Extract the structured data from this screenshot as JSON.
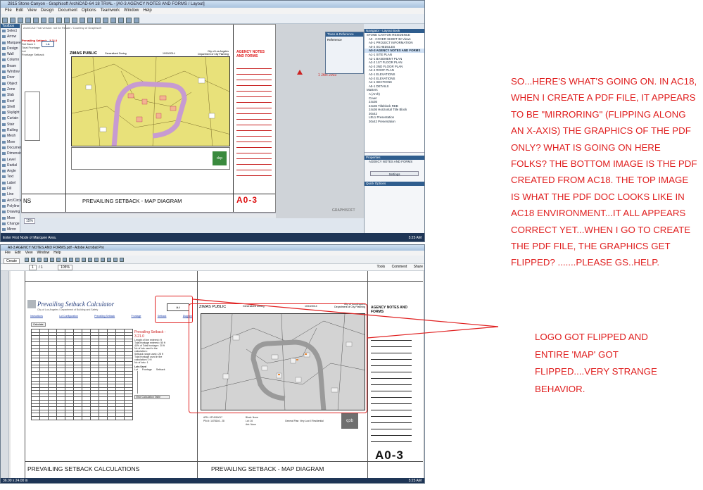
{
  "colors": {
    "annotation_red": "#e02020",
    "map_yellow": "#e8e17a",
    "map_purple": "#c79bd1"
  },
  "archicad": {
    "window_title": "2815 Stone Canyon - Graphisoft ArchiCAD-64 18 TRIAL - [A0-3 AGENCY NOTES AND FORMS / Layout]",
    "menu": [
      "File",
      "Edit",
      "View",
      "Design",
      "Document",
      "Options",
      "Teamwork",
      "Window",
      "Help"
    ],
    "toolbox_header": "Toolbox",
    "toolbox_items": [
      "Select",
      "Arrow",
      "Marquee",
      "Design",
      "Wall",
      "Column",
      "Beam",
      "Window",
      "Door",
      "Object",
      "Zone",
      "Slab",
      "Roof",
      "Shell",
      "Skylight",
      "Curtain",
      "Stair",
      "Railing",
      "Mesh",
      "More",
      "Document",
      "Dimension",
      "Level",
      "Radial",
      "Angle",
      "Text",
      "Label",
      "Fill",
      "Line",
      "Arc/Circle",
      "Polyline",
      "Drawing",
      "More",
      "Change",
      "Mirror"
    ],
    "sheet": {
      "header_note": "ArchiCAD Trial version: not for Resale / Courtesy of Graphisoft",
      "map_title": "ZIMAS PUBLIC",
      "map_subtitle": "Generalized Zoning",
      "map_date": "10/15/2014",
      "map_agency": "City of Los Angeles Department of City Planning",
      "agency_title": "AGENCY NOTES AND FORMS",
      "drawing_title": "PREVAILING SETBACK - MAP DIAGRAM",
      "left_title": "NS",
      "sheet_number": "A0-3",
      "left_items": [
        "Prevailing Setback - 3.21.0",
        "Set Back 1",
        "Total Frontage",
        "Lot",
        "Frontage Setback"
      ],
      "watermark": "GRAPHISOFT",
      "mark": "1 JAN 2003"
    },
    "trace_palette": {
      "title": "Trace & Reference",
      "label": "Reference"
    },
    "navigator": {
      "title": "Navigator - Layout Book",
      "items": [
        "STONE CANYON RESIDENCE",
        "A0 - COVER SHEET 32 Views",
        "A0-1 PROJECT INFORMATION",
        "A0-2 SCHEDULES",
        "A0-3 AGENCY NOTES AND FORMS",
        "A1-1 SITE PLAN",
        "A2-1 BASEMENT PLAN",
        "A2-2 1ST FLOOR PLAN",
        "A2-3 2ND FLOOR PLAN",
        "A2-4 ROOF PLAN",
        "A3-1 ELEVATIONS",
        "A3-2 ELEVATIONS",
        "A4-1 SECTIONS",
        "A5-1 DETAILS",
        "Masters",
        "A (Arch)",
        "Cover",
        "24x36",
        "24x36 Titleblock REB",
        "24x36 Horizontal Title Block",
        "30x42",
        "LEL1 Presentation",
        "30x42 Presentation"
      ],
      "properties": "Properties",
      "prop_value": "AGENCY NOTES AND FORMS",
      "settings": "Settings",
      "quick_options": "Quick Options"
    },
    "status": "Enter First Node of Marquee Area.",
    "zoom": "15%",
    "clock": "5:25 AM"
  },
  "acrobat": {
    "window_title": "A0-3 AGENCY NOTES AND FORMS.pdf - Adobe Acrobat Pro",
    "menu": [
      "File",
      "Edit",
      "View",
      "Window",
      "Help"
    ],
    "create_label": "Create",
    "page_num": "1",
    "page_total": "/ 1",
    "zoom": "105%",
    "right_tools": [
      "Tools",
      "Comment",
      "Share"
    ],
    "sheet": {
      "calc_title": "Prevailing Setback Calculator",
      "calc_subtitle": "City of Los Angeles / Department of Building and Safety",
      "calc_links": [
        "Instructions",
        "Lot Configuration",
        "Prevailing Setback",
        "Frontage",
        "Setback",
        "Diagram"
      ],
      "calc_button": "Calculate",
      "result_title": "Prevailing Setback - 3.21.0",
      "result_notes": [
        "Length of line entered= ft",
        "Total frontage entered= 50 ft",
        "40% of Total frontage= 20 ft",
        "No of lots used in the calculation=",
        "Setback range used= 25 ft",
        "Total frontage used in the calculation= 0 ft",
        "No of lots= 1"
      ],
      "lots_used": "Lots Used",
      "lots_cols": [
        "Lot",
        "Frontage",
        "Setback"
      ],
      "view_table": "View Calculation Table",
      "map_title": "ZIMAS PUBLIC",
      "map_subtitle": "Generalized Zoning",
      "map_date": "10/15/2014",
      "map_agency": "City of Los Angeles Department of City Planning",
      "agency_title": "AGENCY NOTES AND FORMS",
      "left_drawing_title": "PREVAILING SETBACK CALCULATIONS",
      "right_drawing_title": "PREVAILING SETBACK - MAP DIAGRAM",
      "sheet_number": "A0-3",
      "footer_lines": [
        "APN: 4374016017",
        "PIN #: 147B146 - 28",
        "Block: None",
        "Lot: 16",
        "Arb: None",
        "General Plan: Very Low II Residential"
      ]
    },
    "status": "36.00 x 24.00 in",
    "clock": "5:25 AM"
  },
  "annotation_main": "SO...HERE'S WHAT'S GOING ON. IN AC18, WHEN I CREATE A PDF FILE, IT APPEARS TO BE \"MIRRORING\" (FLIPPING ALONG AN X-AXIS) THE GRAPHICS OF THE PDF ONLY? WHAT IS GOING ON HERE FOLKS? THE BOTTOM IMAGE IS THE PDF CREATED FROM AC18. THE TOP IMAGE IS WHAT THE PDF DOC LOOKS LIKE IN AC18 ENVIRONMENT...IT ALL APPEARS CORRECT YET...WHEN I GO TO CREATE THE PDF FILE, THE GRAPHICS GET FLIPPED? .......PLEASE GS..HELP.",
  "annotation_callout": "LOGO GOT FLIPPED AND ENTIRE 'MAP' GOT FLIPPED....VERY STRANGE BEHAVIOR."
}
